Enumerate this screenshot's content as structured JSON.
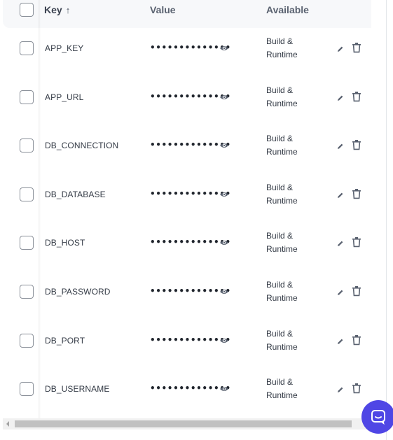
{
  "table": {
    "columns": {
      "key": "Key",
      "key_sort": "↑",
      "value": "Value",
      "available": "Available"
    },
    "rows": [
      {
        "key": "APP_KEY",
        "value_masked": "••••••••••••••",
        "available_line1": "Build &",
        "available_line2": "Runtime"
      },
      {
        "key": "APP_URL",
        "value_masked": "••••••••••••••",
        "available_line1": "Build &",
        "available_line2": "Runtime"
      },
      {
        "key": "DB_CONNECTION",
        "value_masked": "••••••••••••••",
        "available_line1": "Build &",
        "available_line2": "Runtime"
      },
      {
        "key": "DB_DATABASE",
        "value_masked": "••••••••••••••",
        "available_line1": "Build &",
        "available_line2": "Runtime"
      },
      {
        "key": "DB_HOST",
        "value_masked": "••••••••••••••",
        "available_line1": "Build &",
        "available_line2": "Runtime"
      },
      {
        "key": "DB_PASSWORD",
        "value_masked": "••••••••••••••",
        "available_line1": "Build &",
        "available_line2": "Runtime"
      },
      {
        "key": "DB_PORT",
        "value_masked": "••••••••••••••",
        "available_line1": "Build &",
        "available_line2": "Runtime"
      },
      {
        "key": "DB_USERNAME",
        "value_masked": "••••••••••••••",
        "available_line1": "Build &",
        "available_line2": "Runtime"
      }
    ],
    "row_icons": {
      "reveal": "eye-icon",
      "edit": "pencil-icon",
      "delete": "trash-icon"
    }
  },
  "chat": {
    "icon": "chat-bubble-icon",
    "color": "#4f46e5"
  },
  "colors": {
    "header_bg": "#f7f8fa",
    "text": "#333a45",
    "icon": "#5a6270"
  }
}
